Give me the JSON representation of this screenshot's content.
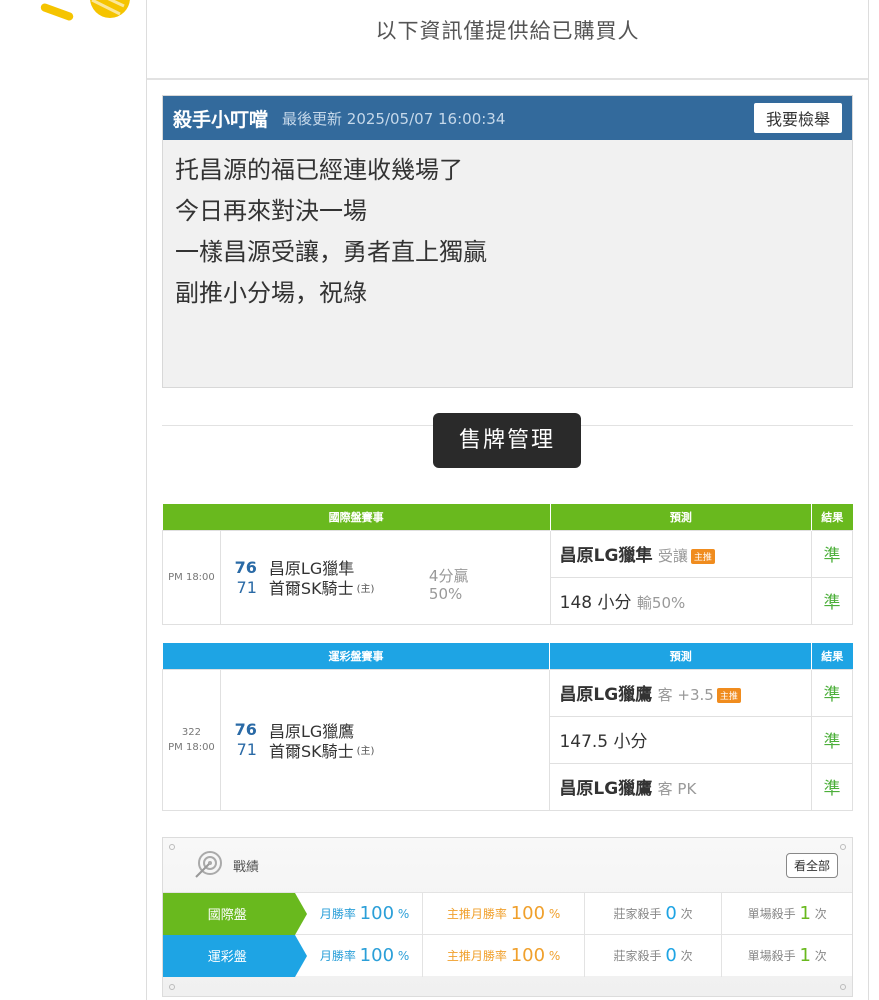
{
  "notice": "以下資訊僅提供給已購買人",
  "message": {
    "author": "殺手小叮噹",
    "updated": "最後更新 2025/05/07 16:00:34",
    "report_label": "我要檢舉",
    "lines": [
      "托昌源的福已經連收幾場了",
      "今日再來對決一場",
      "一樣昌源受讓，勇者直上獨贏",
      "副推小分場，祝綠"
    ]
  },
  "manage_label": "售牌管理",
  "intl": {
    "header_event": "國際盤賽事",
    "header_pred": "預測",
    "header_result": "結果",
    "time": "PM 18:00",
    "away_score": "76",
    "away_team": "昌原LG獵隼",
    "home_score": "71",
    "home_team": "首爾SK騎士",
    "home_tag": "(主)",
    "result_text": "4分贏",
    "result_pct": "50%",
    "pred1_main": "昌原LG獵隼",
    "pred1_sub": "受讓",
    "pred1_badge": "主推",
    "pred1_result": "準",
    "pred2_main": "148 小分",
    "pred2_sub": "輸50%",
    "pred2_result": "準"
  },
  "lottery": {
    "header_event": "運彩盤賽事",
    "header_pred": "預測",
    "header_result": "結果",
    "game_no": "322",
    "time": "PM 18:00",
    "away_score": "76",
    "away_team": "昌原LG獵鷹",
    "home_score": "71",
    "home_team": "首爾SK騎士",
    "home_tag": "(主)",
    "pred1_main": "昌原LG獵鷹",
    "pred1_sub": "客 +3.5",
    "pred1_badge": "主推",
    "pred1_result": "準",
    "pred2_main": "147.5 小分",
    "pred2_result": "準",
    "pred3_main": "昌原LG獵鷹",
    "pred3_sub": "客 PK",
    "pred3_result": "準"
  },
  "record": {
    "title": "戰績",
    "view_all": "看全部",
    "rows": [
      {
        "label": "國際盤",
        "win_label": "月勝率",
        "win": "100",
        "top_label": "主推月勝率",
        "top": "100",
        "pct": "%",
        "banker_label": "莊家殺手",
        "banker": "0",
        "single_label": "單場殺手",
        "single": "1",
        "times": "次"
      },
      {
        "label": "運彩盤",
        "win_label": "月勝率",
        "win": "100",
        "top_label": "主推月勝率",
        "top": "100",
        "pct": "%",
        "banker_label": "莊家殺手",
        "banker": "0",
        "single_label": "單場殺手",
        "single": "1",
        "times": "次"
      }
    ]
  },
  "colors": {
    "green": "#69b91e",
    "blue": "#1ea4e4",
    "header_blue": "#336a9c",
    "orange": "#f0a02c"
  }
}
